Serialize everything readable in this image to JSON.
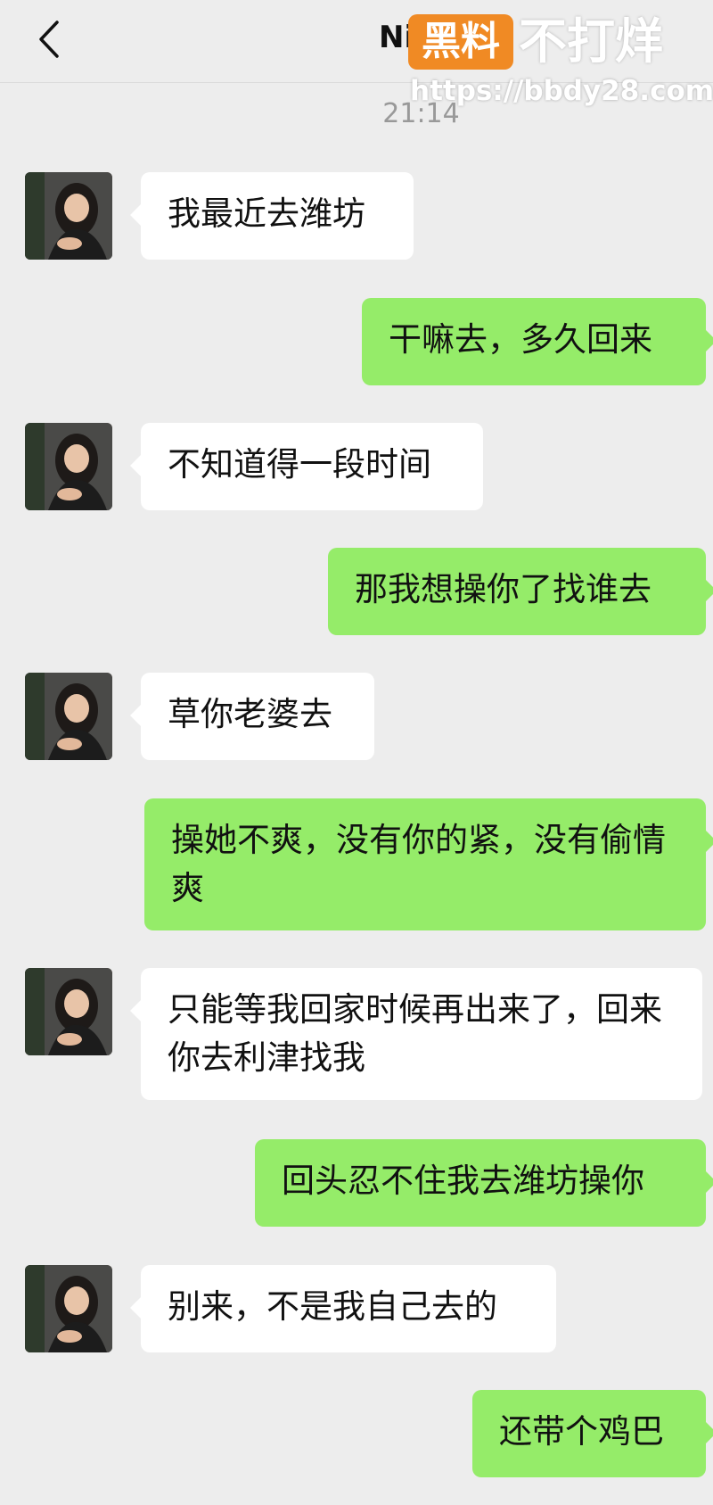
{
  "header": {
    "back_icon": "chevron-left-icon",
    "contact_name": "Ni",
    "watermark_badge": "黑料",
    "watermark_title": "不打烊",
    "watermark_url": "https://bbdy28.com"
  },
  "chat": {
    "timestamp": "21:14",
    "messages": [
      {
        "side": "received",
        "text": "我最近去潍坊"
      },
      {
        "side": "sent",
        "text": "干嘛去，多久回来"
      },
      {
        "side": "received",
        "text": "不知道得一段时间"
      },
      {
        "side": "sent",
        "text": "那我想操你了找谁去"
      },
      {
        "side": "received",
        "text": "草你老婆去"
      },
      {
        "side": "sent",
        "text": "操她不爽，没有你的紧，没有偷情爽"
      },
      {
        "side": "received",
        "text": "只能等我回家时候再出来了，回来你去利津找我"
      },
      {
        "side": "sent",
        "text": "回头忍不住我去潍坊操你"
      },
      {
        "side": "received",
        "text": "别来，不是我自己去的"
      },
      {
        "side": "sent",
        "text": "还带个鸡巴"
      }
    ]
  },
  "colors": {
    "background": "#ededed",
    "sent_bubble": "#95ec69",
    "received_bubble": "#ffffff",
    "watermark_orange": "#f08a24"
  }
}
